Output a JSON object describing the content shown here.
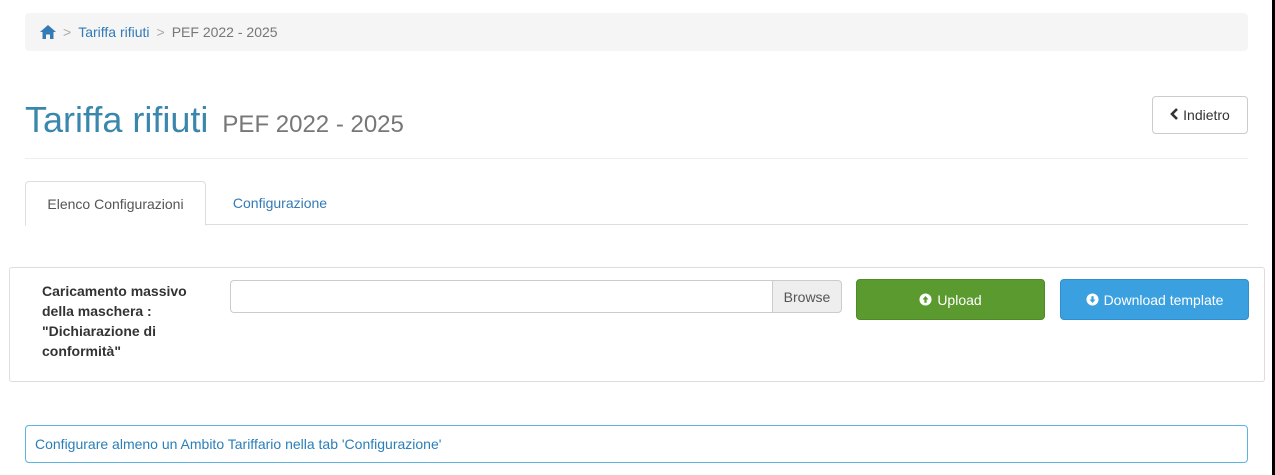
{
  "breadcrumb": {
    "home_icon": "home-icon",
    "items": [
      "Tariffa rifiuti",
      "PEF 2022 - 2025"
    ],
    "separator": ">"
  },
  "header": {
    "title": "Tariffa rifiuti",
    "subtitle": "PEF 2022 - 2025",
    "back_label": "Indietro",
    "back_icon": "chevron-left-icon"
  },
  "tabs": [
    {
      "label": "Elenco Configurazioni",
      "active": true
    },
    {
      "label": "Configurazione",
      "active": false
    }
  ],
  "upload_panel": {
    "label_lines": [
      "Caricamento massivo",
      "della maschera :",
      "\"Dichiarazione di",
      "conformità\""
    ],
    "file_value": "",
    "browse_label": "Browse",
    "upload_label": "Upload",
    "upload_icon": "upload-circle-icon",
    "download_label": "Download template",
    "download_icon": "download-circle-icon"
  },
  "alert": {
    "text": "Configurare almeno un Ambito Tariffario nella tab 'Configurazione'"
  },
  "colors": {
    "title": "#3a87ad",
    "link": "#337ab7",
    "upload_button": "#5b9a2e",
    "download_button": "#3ba0e0",
    "alert_border": "#5bb5e0"
  }
}
